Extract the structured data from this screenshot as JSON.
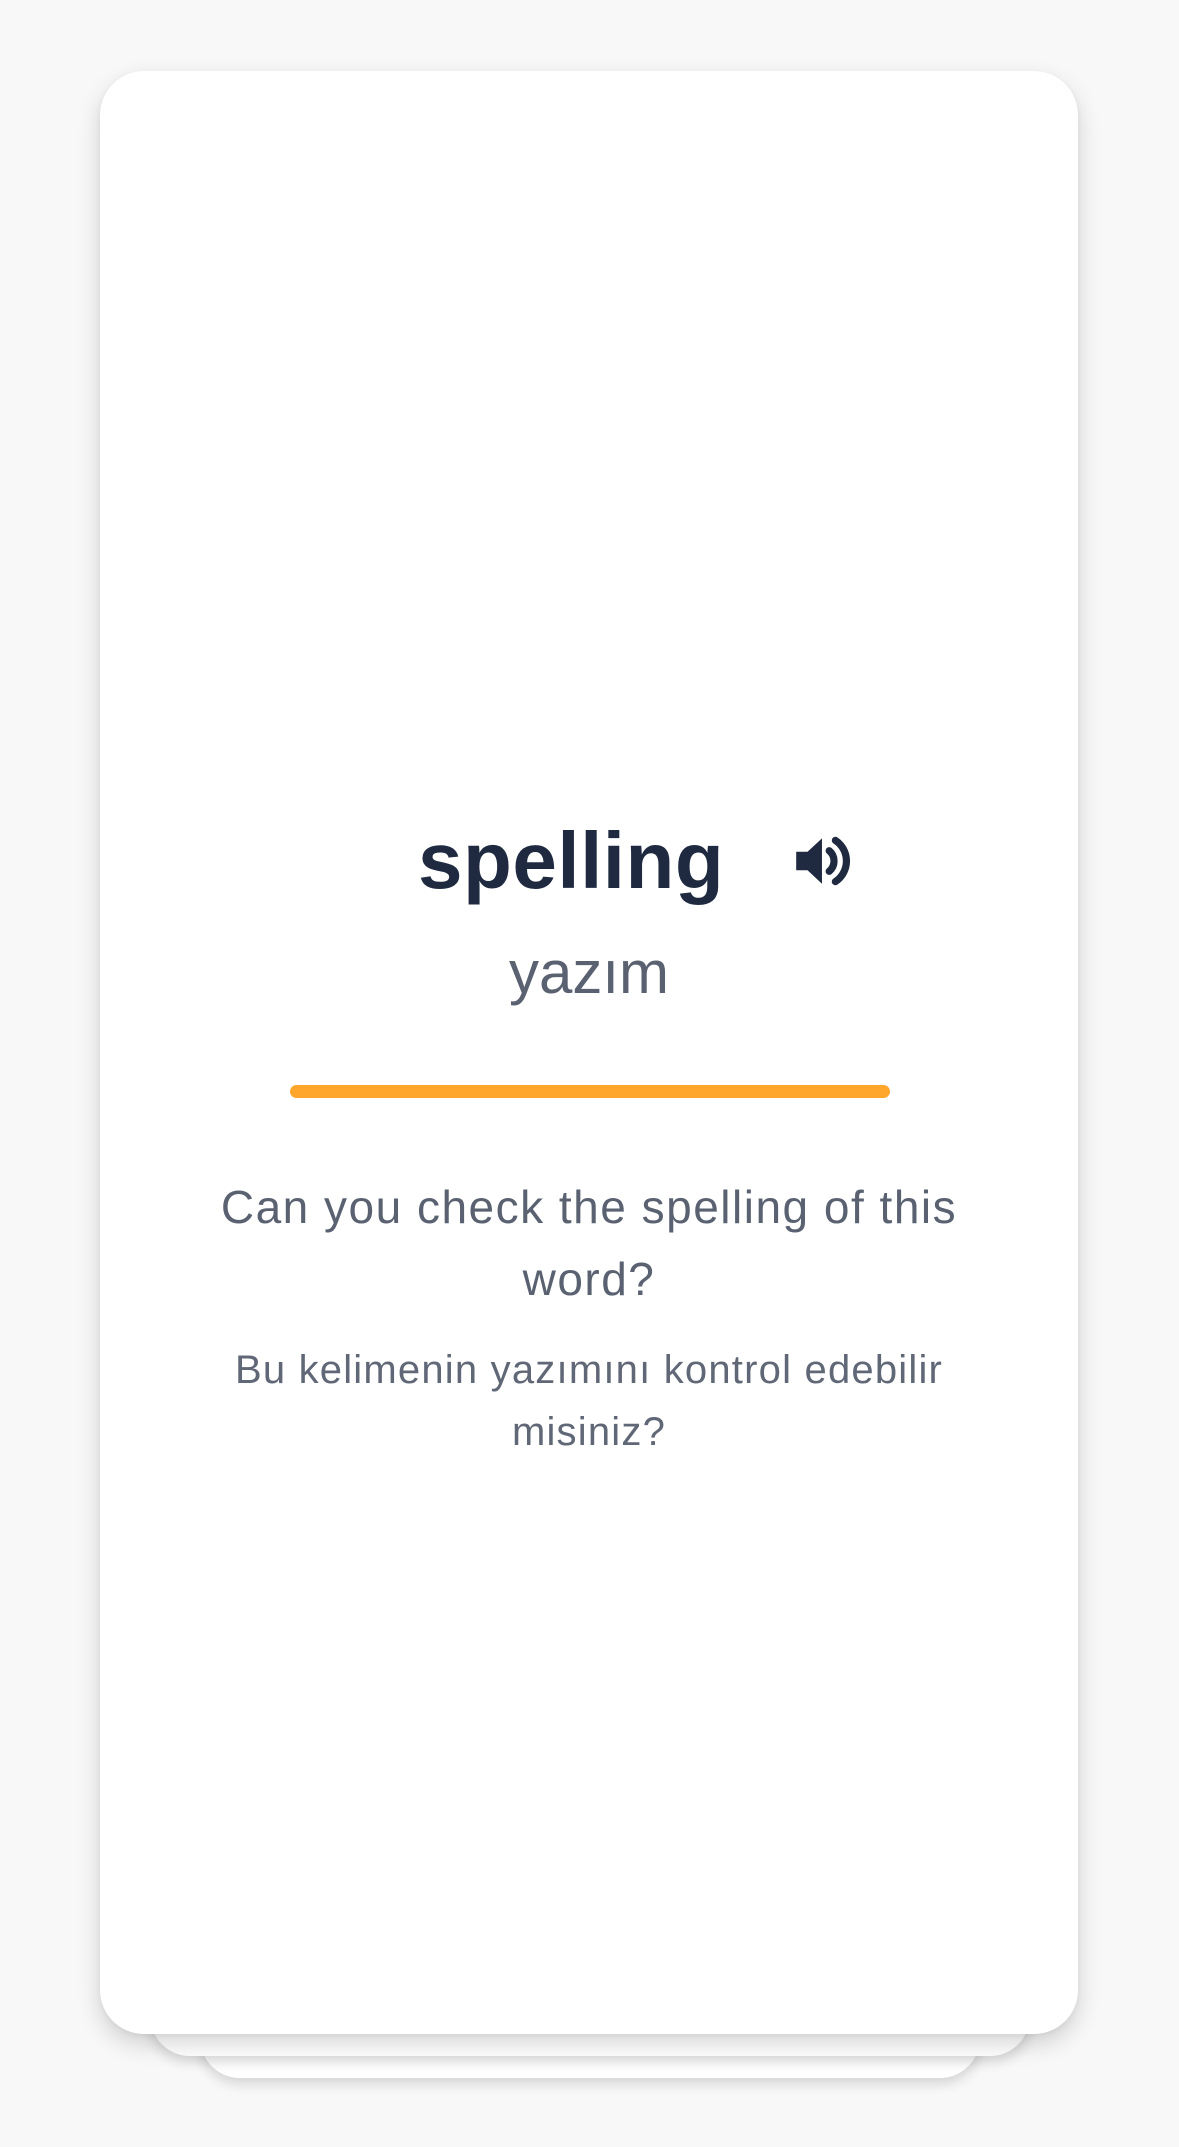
{
  "card": {
    "word": "spelling",
    "translation": "yazım",
    "example_sentence": "Can you check the spelling of this word?",
    "example_translation": "Bu kelimenin yazımını kontrol edebilir misiniz?",
    "audio_icon": "speaker-icon",
    "accent_color": "#ffa62b",
    "word_color": "#1f2a40",
    "secondary_text_color": "#5a6272"
  }
}
